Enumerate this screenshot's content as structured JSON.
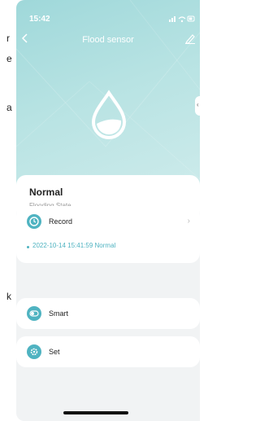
{
  "background_page": {
    "fragments": [
      "r",
      "e",
      "a",
      "k"
    ]
  },
  "status_bar": {
    "time": "15:42",
    "icons": "signal-icon wifi-icon battery-icon"
  },
  "header": {
    "title": "Flood sensor",
    "back_icon": "chevron-left-icon",
    "edit_icon": "edit-pencil-icon"
  },
  "hero": {
    "icon": "water-drop-icon",
    "colors": {
      "gradient_start": "#9fd8da",
      "gradient_end": "#d0ecec"
    }
  },
  "state": {
    "value": "Normal",
    "label": "Flooding State"
  },
  "record": {
    "label": "Record",
    "icon": "clock-icon",
    "latest_entry": "2022-10-14 15:41:59 Normal"
  },
  "smart": {
    "label": "Smart",
    "icon": "toggle-icon"
  },
  "set": {
    "label": "Set",
    "icon": "gear-icon"
  },
  "colors": {
    "accent": "#4fb3c1"
  }
}
